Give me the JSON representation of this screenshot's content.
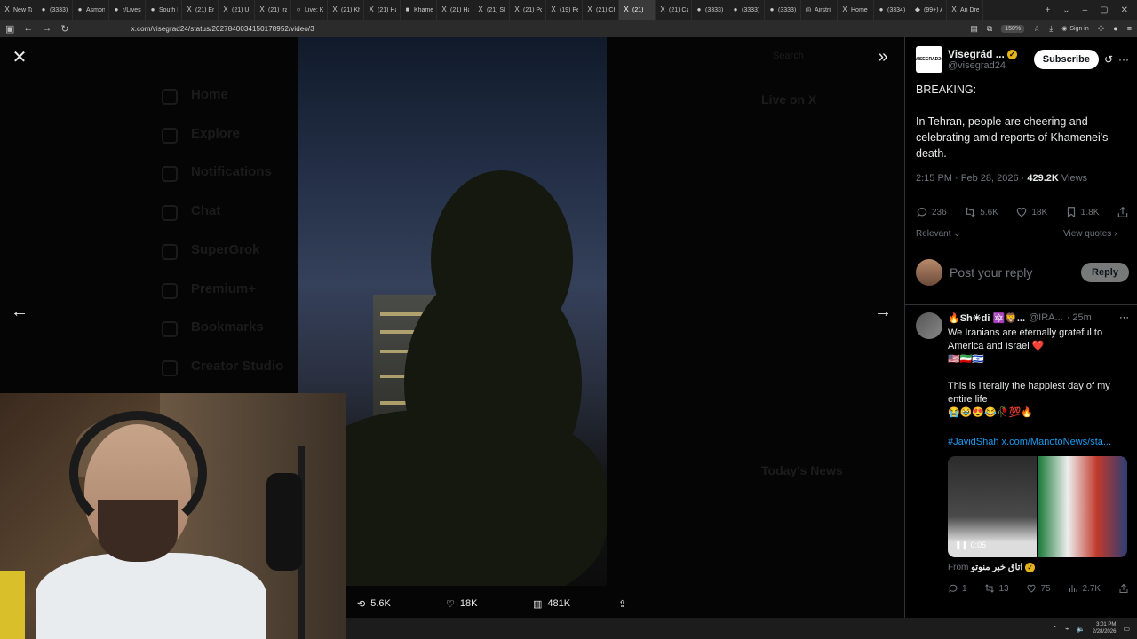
{
  "browser": {
    "tabs": [
      {
        "label": "New Ta",
        "icon": "X"
      },
      {
        "label": "(3333)",
        "icon": "●"
      },
      {
        "label": "Asmon",
        "icon": "●"
      },
      {
        "label": "r/Livest",
        "icon": "●"
      },
      {
        "label": "South K",
        "icon": "●"
      },
      {
        "label": "(21) En",
        "icon": "X"
      },
      {
        "label": "(21) US",
        "icon": "X"
      },
      {
        "label": "(21) Ira",
        "icon": "X"
      },
      {
        "label": "Live: Ki",
        "icon": "○"
      },
      {
        "label": "(21) Kh",
        "icon": "X"
      },
      {
        "label": "(21) Ha",
        "icon": "X"
      },
      {
        "label": "Khame",
        "icon": "■"
      },
      {
        "label": "(21) Ha",
        "icon": "X"
      },
      {
        "label": "(21) Sh",
        "icon": "X"
      },
      {
        "label": "(21) Po",
        "icon": "X"
      },
      {
        "label": "(19) Pe",
        "icon": "X"
      },
      {
        "label": "(21) Ch",
        "icon": "X"
      },
      {
        "label": "(21)",
        "icon": "X"
      },
      {
        "label": "(21) Ca",
        "icon": "X"
      },
      {
        "label": "(3333)",
        "icon": "●"
      },
      {
        "label": "(3333)",
        "icon": "●"
      },
      {
        "label": "(3333)",
        "icon": "●"
      },
      {
        "label": "Airstri",
        "icon": "◎"
      },
      {
        "label": "Home",
        "icon": "X"
      },
      {
        "label": "(3334)",
        "icon": "●"
      },
      {
        "label": "(99+) A",
        "icon": "◆"
      },
      {
        "label": "Ari Dre",
        "icon": "X"
      }
    ],
    "active_tab_index": 17,
    "url": "x.com/visegrad24/status/2027840034150178952/video/3",
    "zoom": "150%",
    "signin_label": "Sign in"
  },
  "viewer": {
    "media_actions": {
      "retweets": "5.6K",
      "likes": "18K",
      "views": "481K"
    },
    "ghost_nav": [
      "Home",
      "Explore",
      "Notifications",
      "Chat",
      "SuperGrok",
      "Premium+",
      "Bookmarks",
      "Creator Studio"
    ],
    "ghost_right": {
      "search": "Search",
      "live_title": "Live on X",
      "news_title": "Today's News"
    }
  },
  "taskbar": {
    "time": "3:01 PM",
    "date": "2/28/2026"
  },
  "sidebar": {
    "account_name": "Visegrád ...",
    "account_handle": "@visegrad24",
    "logo_text": "VISEGRAD24",
    "subscribe_label": "Subscribe",
    "tweet_lines": [
      "BREAKING:",
      "In Tehran, people are cheering and celebrating amid reports of Khamenei's death."
    ],
    "meta_time": "2:15 PM · Feb 28, 2026 · ",
    "meta_views": "429.2K",
    "meta_views_label": " Views",
    "actions": {
      "replies": "236",
      "retweets": "5.6K",
      "likes": "18K",
      "bookmarks": "1.8K"
    },
    "relevant_label": "Relevant",
    "view_quotes_label": "View quotes",
    "reply_placeholder": "Post your reply",
    "reply_button": "Reply",
    "reply": {
      "name": "🔥Sh☀di 🔯🦁...",
      "handle": "@IRA...",
      "time": "· 25m",
      "text1": "We Iranians are eternally grateful to America and Israel ❤️",
      "flags": "🇺🇸🇮🇷🇮🇱",
      "text2": "This is literally the happiest day of my entire life",
      "emojis": "😭🥹😍😂🥀💯🔥",
      "link": "#JavidShah x.com/ManotoNews/sta...",
      "duration": "0:05",
      "from_label": "From",
      "from_name": "اتاق خبر منوتو",
      "actions": {
        "replies": "1",
        "retweets": "13",
        "likes": "75",
        "views": "2.7K"
      }
    }
  }
}
